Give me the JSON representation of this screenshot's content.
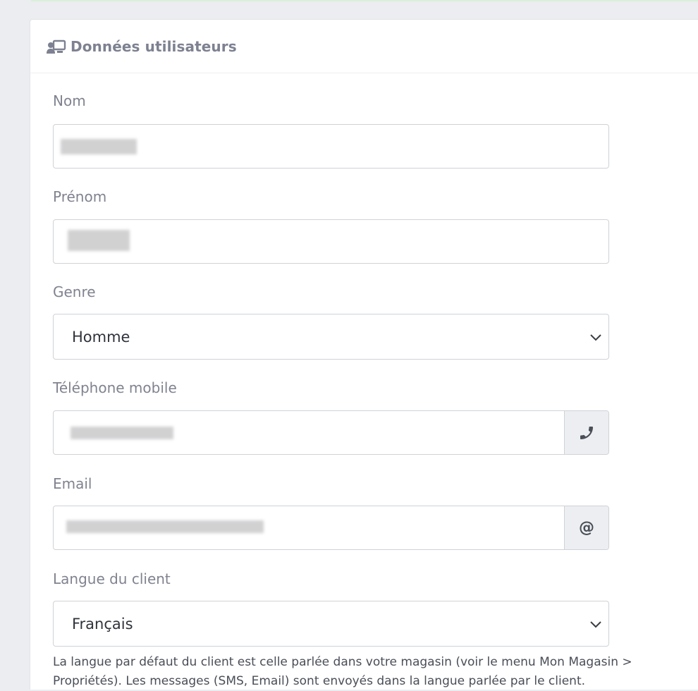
{
  "card": {
    "title": "Données utilisateurs",
    "icon": "user-screen-icon"
  },
  "form": {
    "nom": {
      "label": "Nom",
      "value": ""
    },
    "prenom": {
      "label": "Prénom",
      "value": ""
    },
    "genre": {
      "label": "Genre",
      "selected": "Homme"
    },
    "telephone": {
      "label": "Téléphone mobile",
      "value": "",
      "addon_icon": "phone-icon"
    },
    "email": {
      "label": "Email",
      "value": "",
      "addon_symbol": "@"
    },
    "langue": {
      "label": "Langue du client",
      "selected": "Français",
      "help": "La langue par défaut du client est celle parlée dans votre magasin (voir le menu Mon Magasin > Propriétés). Les messages (SMS, Email) sont envoyés dans la langue parlée par le client."
    }
  },
  "colors": {
    "label": "#80838f",
    "border": "#cfd2d7",
    "addon_bg": "#eceef1",
    "page_bg": "#ebedf0"
  }
}
